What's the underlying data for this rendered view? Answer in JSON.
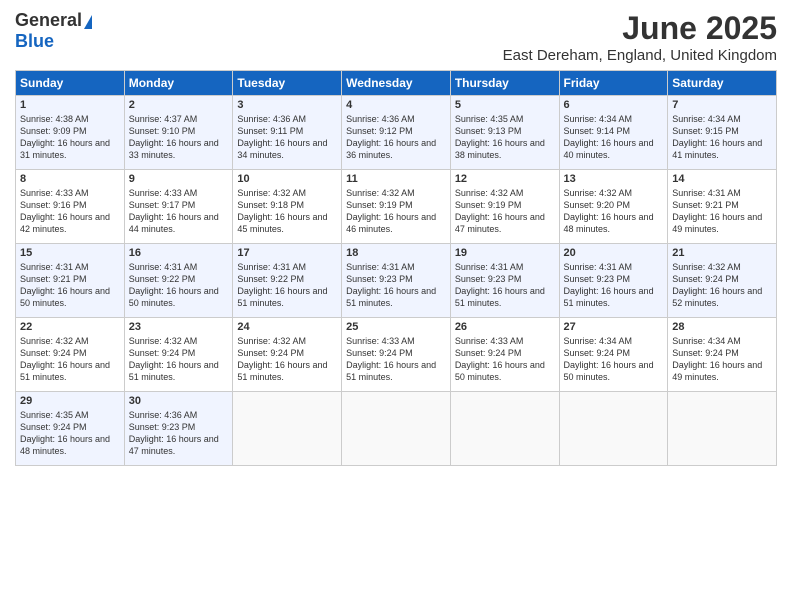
{
  "logo": {
    "general": "General",
    "blue": "Blue"
  },
  "title": "June 2025",
  "location": "East Dereham, England, United Kingdom",
  "headers": [
    "Sunday",
    "Monday",
    "Tuesday",
    "Wednesday",
    "Thursday",
    "Friday",
    "Saturday"
  ],
  "weeks": [
    [
      {
        "day": "1",
        "sunrise": "Sunrise: 4:38 AM",
        "sunset": "Sunset: 9:09 PM",
        "daylight": "Daylight: 16 hours and 31 minutes."
      },
      {
        "day": "2",
        "sunrise": "Sunrise: 4:37 AM",
        "sunset": "Sunset: 9:10 PM",
        "daylight": "Daylight: 16 hours and 33 minutes."
      },
      {
        "day": "3",
        "sunrise": "Sunrise: 4:36 AM",
        "sunset": "Sunset: 9:11 PM",
        "daylight": "Daylight: 16 hours and 34 minutes."
      },
      {
        "day": "4",
        "sunrise": "Sunrise: 4:36 AM",
        "sunset": "Sunset: 9:12 PM",
        "daylight": "Daylight: 16 hours and 36 minutes."
      },
      {
        "day": "5",
        "sunrise": "Sunrise: 4:35 AM",
        "sunset": "Sunset: 9:13 PM",
        "daylight": "Daylight: 16 hours and 38 minutes."
      },
      {
        "day": "6",
        "sunrise": "Sunrise: 4:34 AM",
        "sunset": "Sunset: 9:14 PM",
        "daylight": "Daylight: 16 hours and 40 minutes."
      },
      {
        "day": "7",
        "sunrise": "Sunrise: 4:34 AM",
        "sunset": "Sunset: 9:15 PM",
        "daylight": "Daylight: 16 hours and 41 minutes."
      }
    ],
    [
      {
        "day": "8",
        "sunrise": "Sunrise: 4:33 AM",
        "sunset": "Sunset: 9:16 PM",
        "daylight": "Daylight: 16 hours and 42 minutes."
      },
      {
        "day": "9",
        "sunrise": "Sunrise: 4:33 AM",
        "sunset": "Sunset: 9:17 PM",
        "daylight": "Daylight: 16 hours and 44 minutes."
      },
      {
        "day": "10",
        "sunrise": "Sunrise: 4:32 AM",
        "sunset": "Sunset: 9:18 PM",
        "daylight": "Daylight: 16 hours and 45 minutes."
      },
      {
        "day": "11",
        "sunrise": "Sunrise: 4:32 AM",
        "sunset": "Sunset: 9:19 PM",
        "daylight": "Daylight: 16 hours and 46 minutes."
      },
      {
        "day": "12",
        "sunrise": "Sunrise: 4:32 AM",
        "sunset": "Sunset: 9:19 PM",
        "daylight": "Daylight: 16 hours and 47 minutes."
      },
      {
        "day": "13",
        "sunrise": "Sunrise: 4:32 AM",
        "sunset": "Sunset: 9:20 PM",
        "daylight": "Daylight: 16 hours and 48 minutes."
      },
      {
        "day": "14",
        "sunrise": "Sunrise: 4:31 AM",
        "sunset": "Sunset: 9:21 PM",
        "daylight": "Daylight: 16 hours and 49 minutes."
      }
    ],
    [
      {
        "day": "15",
        "sunrise": "Sunrise: 4:31 AM",
        "sunset": "Sunset: 9:21 PM",
        "daylight": "Daylight: 16 hours and 50 minutes."
      },
      {
        "day": "16",
        "sunrise": "Sunrise: 4:31 AM",
        "sunset": "Sunset: 9:22 PM",
        "daylight": "Daylight: 16 hours and 50 minutes."
      },
      {
        "day": "17",
        "sunrise": "Sunrise: 4:31 AM",
        "sunset": "Sunset: 9:22 PM",
        "daylight": "Daylight: 16 hours and 51 minutes."
      },
      {
        "day": "18",
        "sunrise": "Sunrise: 4:31 AM",
        "sunset": "Sunset: 9:23 PM",
        "daylight": "Daylight: 16 hours and 51 minutes."
      },
      {
        "day": "19",
        "sunrise": "Sunrise: 4:31 AM",
        "sunset": "Sunset: 9:23 PM",
        "daylight": "Daylight: 16 hours and 51 minutes."
      },
      {
        "day": "20",
        "sunrise": "Sunrise: 4:31 AM",
        "sunset": "Sunset: 9:23 PM",
        "daylight": "Daylight: 16 hours and 51 minutes."
      },
      {
        "day": "21",
        "sunrise": "Sunrise: 4:32 AM",
        "sunset": "Sunset: 9:24 PM",
        "daylight": "Daylight: 16 hours and 52 minutes."
      }
    ],
    [
      {
        "day": "22",
        "sunrise": "Sunrise: 4:32 AM",
        "sunset": "Sunset: 9:24 PM",
        "daylight": "Daylight: 16 hours and 51 minutes."
      },
      {
        "day": "23",
        "sunrise": "Sunrise: 4:32 AM",
        "sunset": "Sunset: 9:24 PM",
        "daylight": "Daylight: 16 hours and 51 minutes."
      },
      {
        "day": "24",
        "sunrise": "Sunrise: 4:32 AM",
        "sunset": "Sunset: 9:24 PM",
        "daylight": "Daylight: 16 hours and 51 minutes."
      },
      {
        "day": "25",
        "sunrise": "Sunrise: 4:33 AM",
        "sunset": "Sunset: 9:24 PM",
        "daylight": "Daylight: 16 hours and 51 minutes."
      },
      {
        "day": "26",
        "sunrise": "Sunrise: 4:33 AM",
        "sunset": "Sunset: 9:24 PM",
        "daylight": "Daylight: 16 hours and 50 minutes."
      },
      {
        "day": "27",
        "sunrise": "Sunrise: 4:34 AM",
        "sunset": "Sunset: 9:24 PM",
        "daylight": "Daylight: 16 hours and 50 minutes."
      },
      {
        "day": "28",
        "sunrise": "Sunrise: 4:34 AM",
        "sunset": "Sunset: 9:24 PM",
        "daylight": "Daylight: 16 hours and 49 minutes."
      }
    ],
    [
      {
        "day": "29",
        "sunrise": "Sunrise: 4:35 AM",
        "sunset": "Sunset: 9:24 PM",
        "daylight": "Daylight: 16 hours and 48 minutes."
      },
      {
        "day": "30",
        "sunrise": "Sunrise: 4:36 AM",
        "sunset": "Sunset: 9:23 PM",
        "daylight": "Daylight: 16 hours and 47 minutes."
      },
      null,
      null,
      null,
      null,
      null
    ]
  ]
}
